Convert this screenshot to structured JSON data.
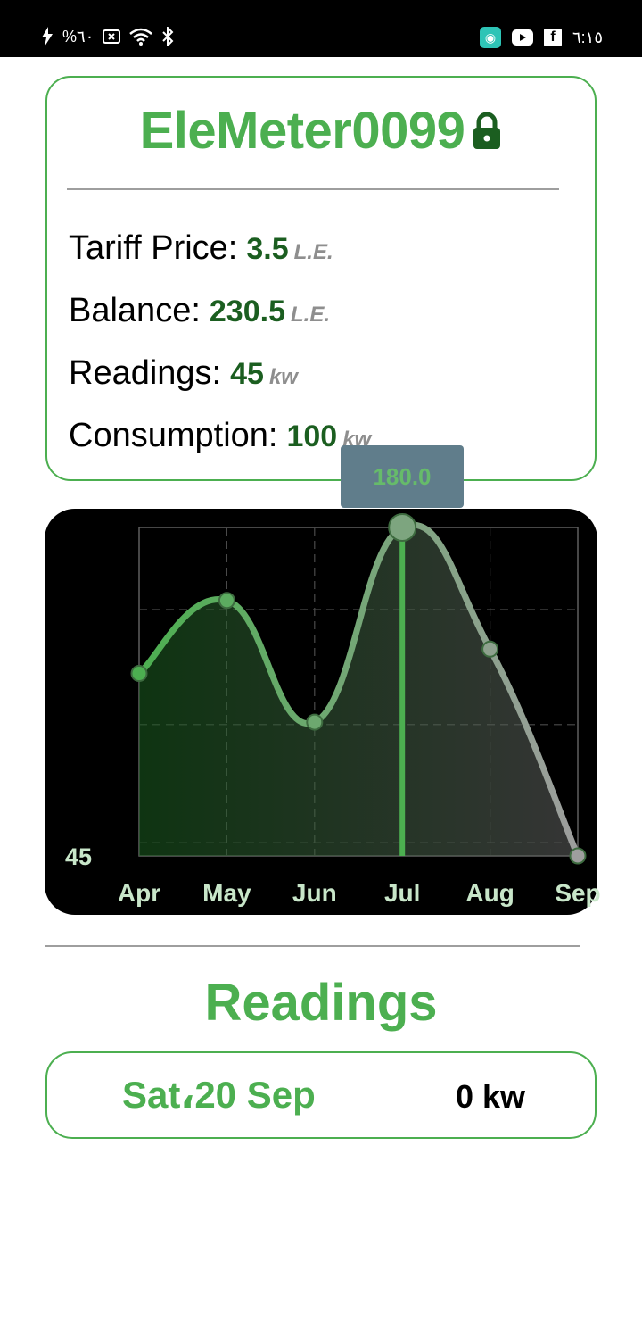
{
  "status_bar": {
    "left_text": "%٦٠",
    "time": "٦:١٥",
    "icons": [
      "charging-bolt-icon",
      "screen-record-icon",
      "wifi-icon",
      "bluetooth-icon",
      "app-notification-icon",
      "youtube-icon",
      "facebook-icon"
    ]
  },
  "meter": {
    "name": "EleMeter0099",
    "lock_icon": "lock-icon",
    "tariff_label": "Tariff Price:",
    "tariff_value": "3.5",
    "tariff_unit": "L.E.",
    "balance_label": "Balance:",
    "balance_value": "230.5",
    "balance_unit": "L.E.",
    "readings_label": "Readings:",
    "readings_value": "45",
    "readings_unit": "kw",
    "consumption_label": "Consumption:",
    "consumption_value": "100",
    "consumption_unit": "kw"
  },
  "chart": {
    "tooltip": "180.0",
    "y_min_label": "45"
  },
  "chart_data": {
    "type": "area",
    "categories": [
      "Apr",
      "May",
      "Jun",
      "Jul",
      "Aug",
      "Sep"
    ],
    "values": [
      120,
      150,
      100,
      180,
      130,
      45
    ],
    "ylim": [
      45,
      180
    ],
    "grid": true,
    "selected_index": 3,
    "selected_value_label": "180.0",
    "colors": {
      "line_start": "#4caf50",
      "line_end": "#9e9e9e",
      "highlight": "#4caf50"
    }
  },
  "readings_section": {
    "title": "Readings",
    "items": [
      {
        "date": "Sat،20 Sep",
        "value": "0 kw"
      }
    ]
  }
}
